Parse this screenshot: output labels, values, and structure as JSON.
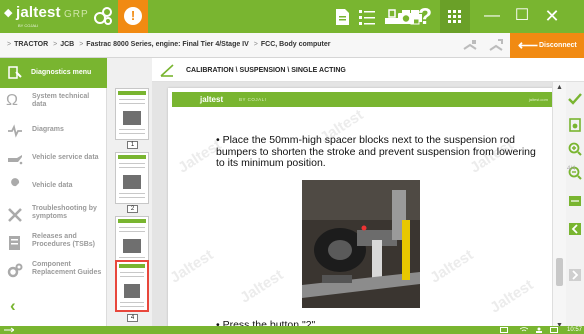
{
  "app": {
    "brand": "jaltest",
    "brand_by": "BY COJALI",
    "group": "GRP"
  },
  "colors": {
    "accent_green": "#79b530",
    "accent_orange": "#f18a12",
    "text_gray": "#9a9a9a"
  },
  "breadcrumb": {
    "items": [
      "TRACTOR",
      "JCB",
      "Fastrac 8000 Series, engine: Final Tier 4/Stage IV",
      "FCC, Body computer"
    ]
  },
  "disconnect_label": "Disconnect",
  "sidebar": {
    "header": "Diagnostics menu",
    "items": [
      {
        "label": "System technical data",
        "icon": "ohm-icon"
      },
      {
        "label": "Diagrams",
        "icon": "circuit-icon"
      },
      {
        "label": "Vehicle service data",
        "icon": "oil-can-icon"
      },
      {
        "label": "Vehicle data",
        "icon": "wrench-icon"
      },
      {
        "label": "Troubleshooting by symptoms",
        "icon": "tools-icon"
      },
      {
        "label": "Releases and Procedures (TSBs)",
        "icon": "document-icon"
      },
      {
        "label": "Component Replacement Guides",
        "icon": "gears-icon"
      }
    ]
  },
  "thumbnails": [
    {
      "num": "1"
    },
    {
      "num": "2"
    },
    {
      "num": "3"
    },
    {
      "num": "4"
    }
  ],
  "main": {
    "path": "CALIBRATION \\ SUSPENSION \\ SINGLE ACTING",
    "page_brand": "jaltest",
    "page_by": "BY COJALI",
    "page_site": "jaltest.com",
    "bullet1": "Place the 50mm-high spacer blocks next to the suspension rod bumpers to shorten the stroke and prevent suspension from lowering to its minimum position.",
    "bullet2": "Press the button \"2\".",
    "watermark": "Jaltest"
  },
  "page_indicator": "4/4",
  "status": {
    "time": "10:57"
  }
}
